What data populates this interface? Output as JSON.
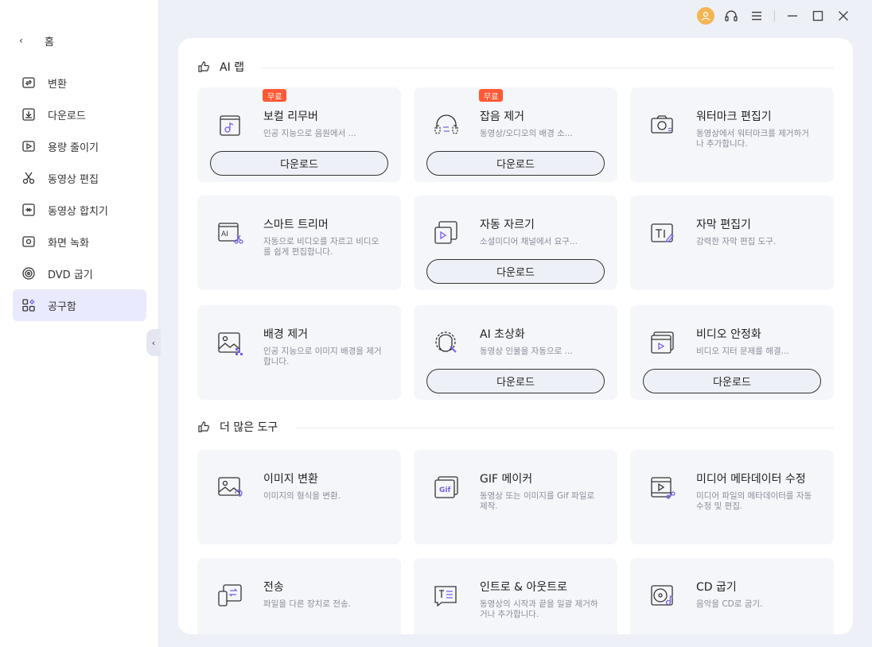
{
  "sidebar": {
    "home_label": "홈",
    "items": [
      {
        "label": "변환",
        "icon": "convert-icon"
      },
      {
        "label": "다운로드",
        "icon": "download-icon"
      },
      {
        "label": "용량 줄이기",
        "icon": "compress-icon"
      },
      {
        "label": "동영상 편집",
        "icon": "scissors-icon"
      },
      {
        "label": "동영상 합치기",
        "icon": "merge-icon"
      },
      {
        "label": "화면 녹화",
        "icon": "screen-record-icon"
      },
      {
        "label": "DVD 굽기",
        "icon": "disc-icon"
      },
      {
        "label": "공구함",
        "icon": "toolbox-icon",
        "active": true
      }
    ]
  },
  "sections": {
    "ai_lab": "AI 랩",
    "more_tools": "더 많은 도구"
  },
  "cards": {
    "vocal_remover": {
      "title": "보컬 리무버",
      "desc": "인공 지능으로 음원에서 ...",
      "button": "다운로드",
      "badge": "무료"
    },
    "noise_remover": {
      "title": "잡음 제거",
      "desc": "동영상/오디오의 배경 소...",
      "button": "다운로드",
      "badge": "무료"
    },
    "watermark_editor": {
      "title": "워터마크 편집기",
      "desc": "동영상에서 워터마크를 제거하거나 추가합니다."
    },
    "smart_trimmer": {
      "title": "스마트 트리머",
      "desc": "자동으로 비디오를 자르고 비디오를 쉽게 편집합니다."
    },
    "auto_crop": {
      "title": "자동 자르기",
      "desc": "소셜미디어 채널에서 요구...",
      "button": "다운로드"
    },
    "subtitle_editor": {
      "title": "자막 편집기",
      "desc": "강력한 자막 편집 도구."
    },
    "bg_remover": {
      "title": "배경 제거",
      "desc": "인공 지능으로 이미지 배경을 제거합니다."
    },
    "ai_portrait": {
      "title": "AI 초상화",
      "desc": "동영상 인물을 자동으로 ...",
      "button": "다운로드"
    },
    "video_stabilizer": {
      "title": "비디오 안정화",
      "desc": "비디오 지터 문제를 해결...",
      "button": "다운로드"
    },
    "image_converter": {
      "title": "이미지 변환",
      "desc": "이미지의 형식을 변환."
    },
    "gif_maker": {
      "title": "GIF 메이커",
      "desc": "동영상 또는 이미지를 Gif 파일로 제작."
    },
    "metadata_fixer": {
      "title": "미디어 메타데이터 수정",
      "desc": "미디어 파일의 메타데이터를 자동 수정 및 편집."
    },
    "transfer": {
      "title": "전송",
      "desc": "파일을 다른 장치로 전송."
    },
    "intro_outro": {
      "title": "인트로 & 아웃트로",
      "desc": "동영상의 시작과 끝을 일괄 제거하거나 추가합니다."
    },
    "cd_burner": {
      "title": "CD 굽기",
      "desc": "음악을 CD로 굽기."
    }
  },
  "colors": {
    "accent": "#7a5cf0",
    "badge": "#ff5a36",
    "active_nav": "#e9eafd",
    "avatar": "#f6b552"
  }
}
